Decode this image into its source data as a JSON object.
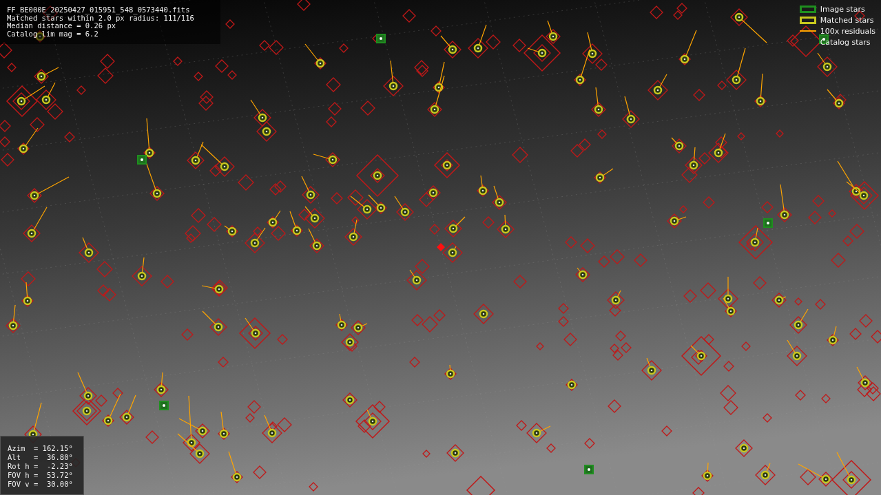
{
  "header": {
    "lines": [
      "FF_BE000E_20250427_015951_548_0573440.fits",
      "Matched stars within 2.0 px radius: 111/116",
      "Median distance = 0.26 px",
      "Catalog lim mag = 6.2"
    ]
  },
  "legend": [
    {
      "label": "Image stars",
      "kind": "box",
      "color": "#1f8f1f"
    },
    {
      "label": "Matched stars",
      "kind": "box",
      "color": "#c8c81e"
    },
    {
      "label": "100x residuals",
      "kind": "line",
      "color": "#ffa500"
    },
    {
      "label": "Catalog stars",
      "kind": "none"
    }
  ],
  "pointing": {
    "lines": [
      "Azim  = 162.15°",
      "Alt   =  36.80°",
      "Rot h =  -2.23°",
      "FOV h =  53.72°",
      "FOV v =  30.00°"
    ]
  }
}
